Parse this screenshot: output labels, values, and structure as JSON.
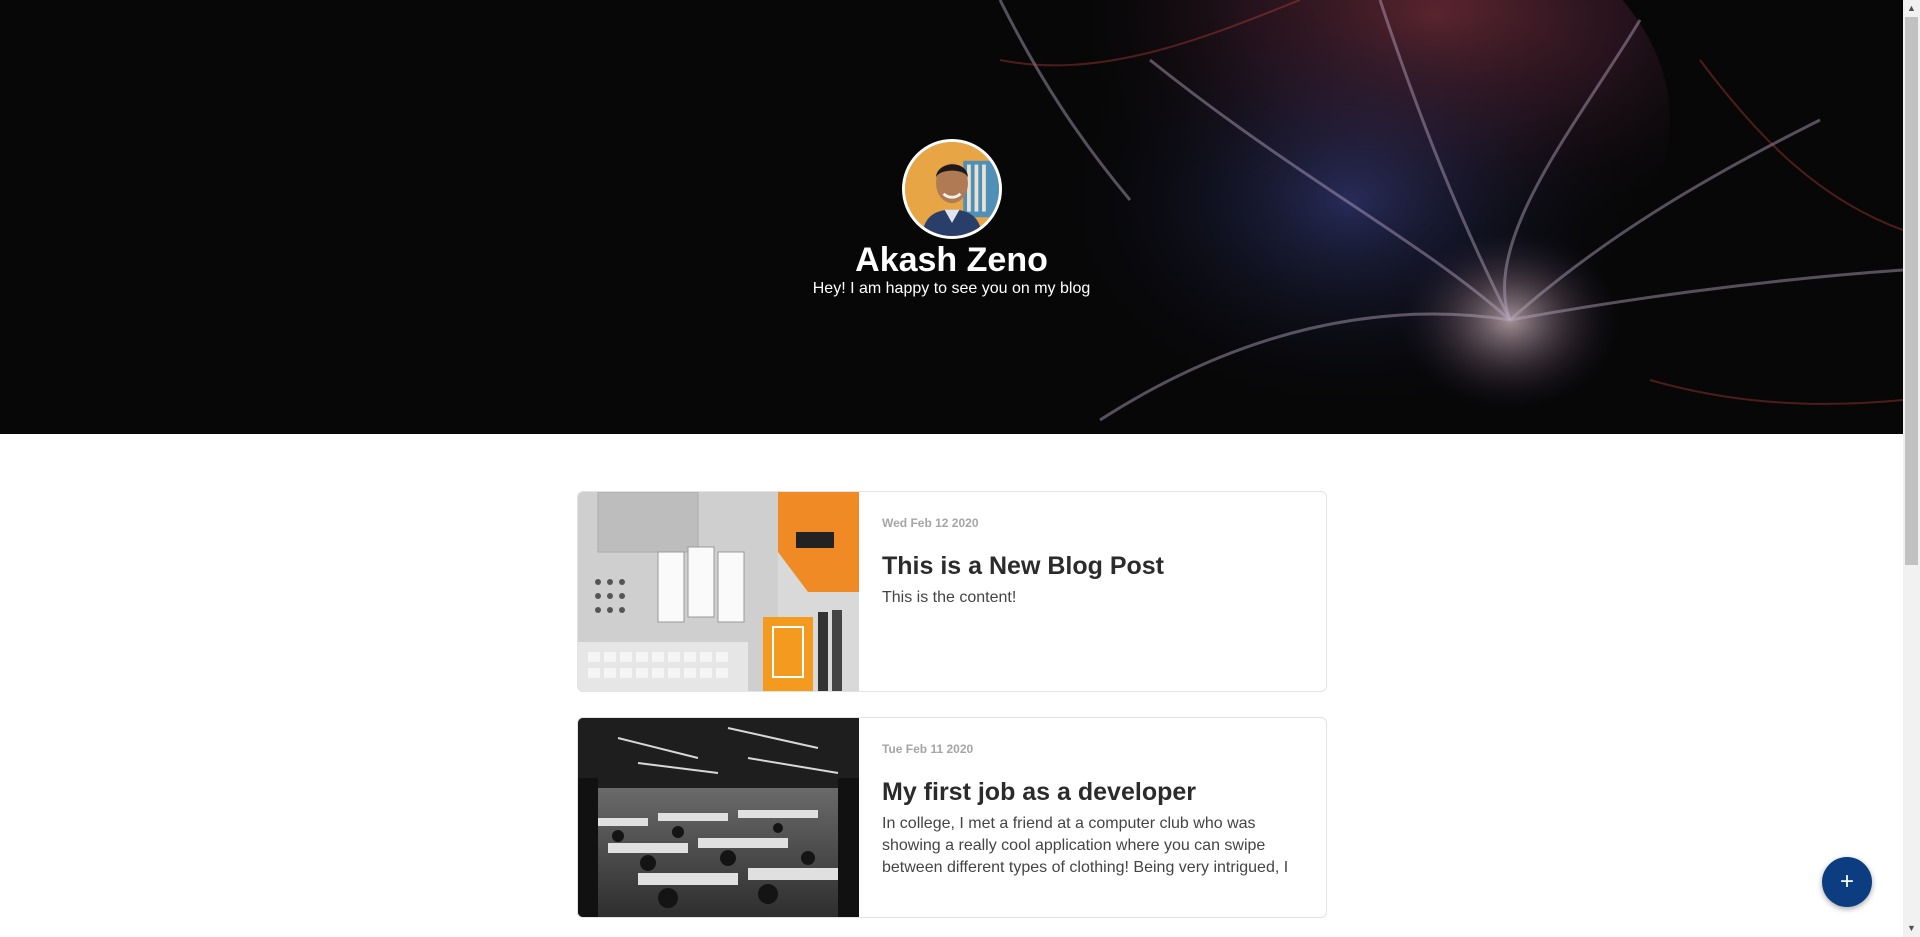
{
  "profile": {
    "name": "Akash Zeno",
    "tagline": "Hey! I am happy to see you on my blog"
  },
  "posts": [
    {
      "date": "Wed Feb 12 2020",
      "title": "This is a New Blog Post",
      "content": "This is the content!"
    },
    {
      "date": "Tue Feb 11 2020",
      "title": "My first job as a developer",
      "content": "In college, I met a friend at a computer club who was showing a really cool application where you can swipe between different types of clothing! Being very intrigued, I"
    }
  ],
  "fab": {
    "label": "+"
  },
  "colors": {
    "hero_bg": "#070708",
    "fab": "#0b3d80",
    "date": "#a5a5a5",
    "title": "#2b2b2b"
  }
}
